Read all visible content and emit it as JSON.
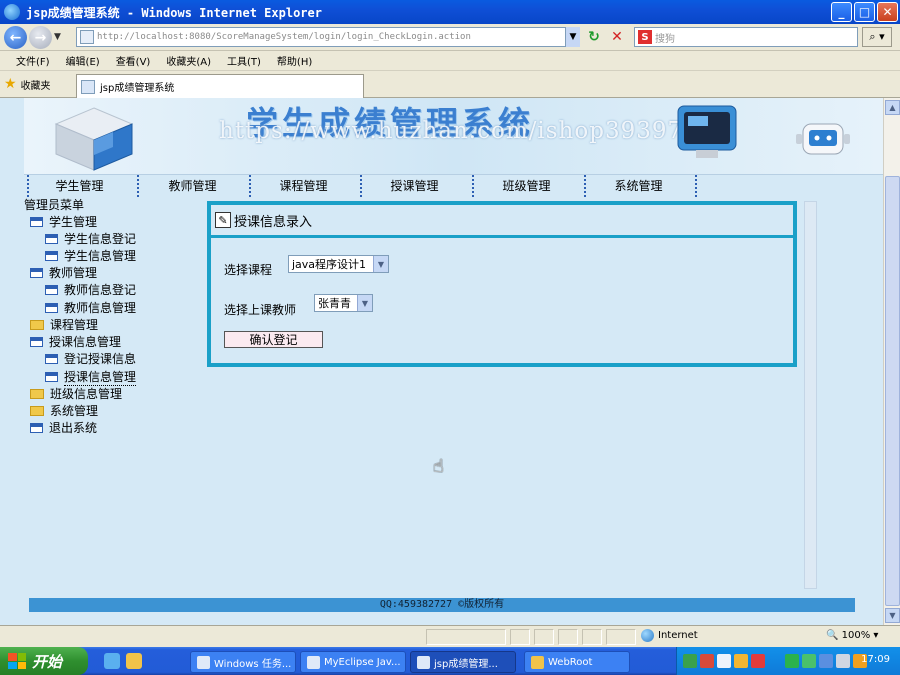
{
  "window": {
    "title": "jsp成绩管理系统 - Windows Internet Explorer",
    "controls": {
      "minimize": "_",
      "maximize": "□",
      "close": "✕"
    }
  },
  "address_bar": {
    "url": "http://localhost:8080/ScoreManageSystem/login/login_CheckLogin.action",
    "search_placeholder": "搜狗"
  },
  "menu": [
    "文件(F)",
    "编辑(E)",
    "查看(V)",
    "收藏夹(A)",
    "工具(T)",
    "帮助(H)"
  ],
  "favorites": {
    "label": "收藏夹"
  },
  "tab": {
    "title": "jsp成绩管理系统"
  },
  "page": {
    "banner_title": "学生成绩管理系统",
    "watermark": "https://www.huzhan.com/ishop39397",
    "nav": [
      "学生管理",
      "教师管理",
      "课程管理",
      "授课管理",
      "班级管理",
      "系统管理"
    ],
    "sidebar": {
      "title": "管理员菜单",
      "items": [
        {
          "label": "学生管理",
          "level": 0,
          "icon": "window-icon"
        },
        {
          "label": "学生信息登记",
          "level": 1,
          "icon": "window-icon"
        },
        {
          "label": "学生信息管理",
          "level": 1,
          "icon": "window-icon"
        },
        {
          "label": "教师管理",
          "level": 0,
          "icon": "window-icon"
        },
        {
          "label": "教师信息登记",
          "level": 1,
          "icon": "window-icon"
        },
        {
          "label": "教师信息管理",
          "level": 1,
          "icon": "window-icon"
        },
        {
          "label": "课程管理",
          "level": 0,
          "icon": "folder-icon"
        },
        {
          "label": "授课信息管理",
          "level": 0,
          "icon": "window-icon"
        },
        {
          "label": "登记授课信息",
          "level": 1,
          "icon": "window-icon"
        },
        {
          "label": "授课信息管理",
          "level": 1,
          "icon": "window-icon"
        },
        {
          "label": "班级信息管理",
          "level": 0,
          "icon": "folder-icon"
        },
        {
          "label": "系统管理",
          "level": 0,
          "icon": "folder-icon"
        },
        {
          "label": "退出系统",
          "level": 0,
          "icon": "window-icon"
        }
      ]
    },
    "form": {
      "heading": "授课信息录入",
      "course_label": "选择课程",
      "course_value": "java程序设计1",
      "teacher_label": "选择上课教师",
      "teacher_value": "张青青",
      "submit_label": "确认登记"
    },
    "footer": "QQ:459382727 ©版权所有"
  },
  "statusbar": {
    "zone": "Internet",
    "zoom": "100%"
  },
  "taskbar": {
    "start": "开始",
    "tasks": [
      "Windows 任务...",
      "MyEclipse Jav...",
      "jsp成绩管理...",
      "WebRoot"
    ],
    "clock": "17:09"
  }
}
